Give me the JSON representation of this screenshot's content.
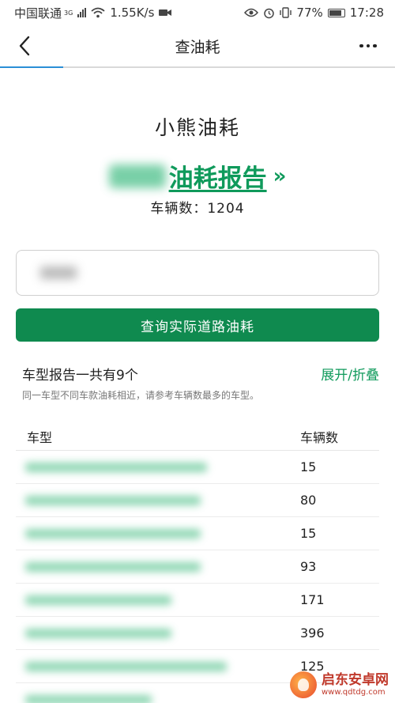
{
  "status_bar": {
    "carrier": "中国联通",
    "network_type": "3G",
    "speed": "1.55K/s",
    "battery": "77%",
    "time": "17:28"
  },
  "nav": {
    "title": "查油耗"
  },
  "hero": {
    "brand_title": "小熊油耗",
    "report_link_text": "油耗报告",
    "report_link_chevron": "»",
    "vehicle_count": "车辆数：1204"
  },
  "query_button": "查询实际道路油耗",
  "report": {
    "count_text": "车型报告一共有9个",
    "toggle_text": "展开/折叠",
    "note": "同一车型不同车款油耗相近，请参考车辆数最多的车型。"
  },
  "table": {
    "headers": [
      "车型",
      "车辆数"
    ],
    "rows": [
      {
        "count": "15"
      },
      {
        "count": "80"
      },
      {
        "count": "15"
      },
      {
        "count": "93"
      },
      {
        "count": "171"
      },
      {
        "count": "396"
      },
      {
        "count": "125"
      },
      {
        "count": ""
      }
    ]
  },
  "watermark": {
    "name": "启东安卓网",
    "url": "www.qdtdg.com"
  },
  "colors": {
    "accent_green": "#0f8a4f",
    "link_green": "#0f9a5b",
    "tab_indicator": "#2a8fd6"
  }
}
